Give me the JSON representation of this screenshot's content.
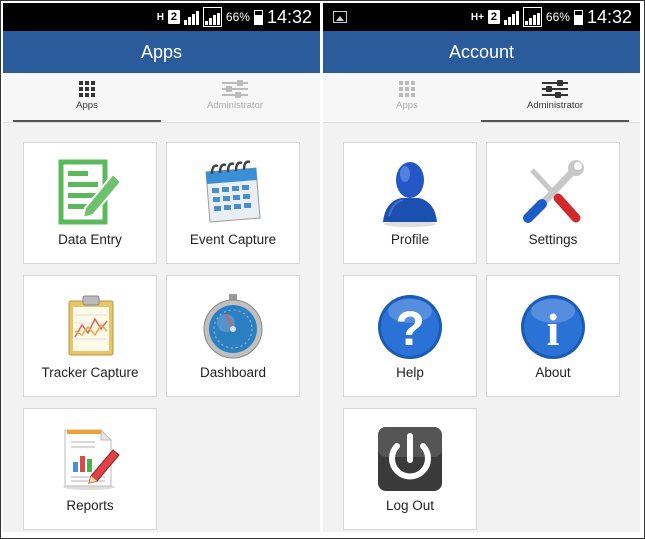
{
  "left": {
    "status": {
      "net": "H",
      "sim": "2",
      "battery": "66%",
      "time": "14:32"
    },
    "title": "Apps",
    "tabs": [
      {
        "label": "Apps"
      },
      {
        "label": "Administrator"
      }
    ],
    "tiles": [
      {
        "label": "Data Entry",
        "icon": "data-entry-icon"
      },
      {
        "label": "Event Capture",
        "icon": "calendar-icon"
      },
      {
        "label": "Tracker Capture",
        "icon": "clipboard-chart-icon"
      },
      {
        "label": "Dashboard",
        "icon": "stopwatch-icon"
      },
      {
        "label": "Reports",
        "icon": "report-icon"
      }
    ]
  },
  "right": {
    "status": {
      "net": "H+",
      "sim": "2",
      "battery": "66%",
      "time": "14:32"
    },
    "title": "Account",
    "tabs": [
      {
        "label": "Apps"
      },
      {
        "label": "Administrator"
      }
    ],
    "tiles": [
      {
        "label": "Profile",
        "icon": "profile-icon"
      },
      {
        "label": "Settings",
        "icon": "tools-icon"
      },
      {
        "label": "Help",
        "icon": "help-icon"
      },
      {
        "label": "About",
        "icon": "info-icon"
      },
      {
        "label": "Log Out",
        "icon": "power-icon"
      }
    ]
  },
  "colors": {
    "appbar": "#2a5b9a",
    "statusbar": "#000000",
    "background": "#f2f2f2"
  }
}
